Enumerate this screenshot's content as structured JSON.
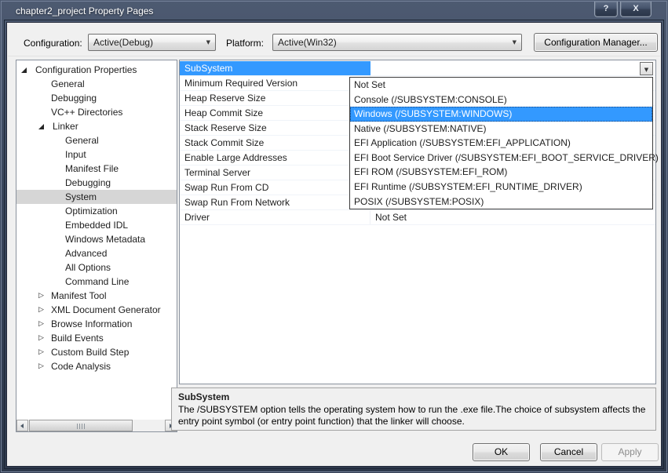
{
  "window": {
    "title": "chapter2_project Property Pages",
    "help_glyph": "?",
    "close_glyph": "X"
  },
  "toolbar": {
    "configuration_label": "Configuration:",
    "configuration_value": "Active(Debug)",
    "platform_label": "Platform:",
    "platform_value": "Active(Win32)",
    "configuration_manager_label": "Configuration Manager..."
  },
  "icons": {
    "dropdown_arrow": "▼",
    "collapsed_arrow": "▷"
  },
  "sidebar": {
    "items": [
      {
        "label": "Configuration Properties",
        "level": 0,
        "state": "expanded",
        "selected": false
      },
      {
        "label": "General",
        "level": 1,
        "state": "leaf",
        "selected": false
      },
      {
        "label": "Debugging",
        "level": 1,
        "state": "leaf",
        "selected": false
      },
      {
        "label": "VC++ Directories",
        "level": 1,
        "state": "leaf",
        "selected": false
      },
      {
        "label": "Linker",
        "level": 1,
        "state": "expanded",
        "selected": false
      },
      {
        "label": "General",
        "level": 2,
        "state": "leaf",
        "selected": false
      },
      {
        "label": "Input",
        "level": 2,
        "state": "leaf",
        "selected": false
      },
      {
        "label": "Manifest File",
        "level": 2,
        "state": "leaf",
        "selected": false
      },
      {
        "label": "Debugging",
        "level": 2,
        "state": "leaf",
        "selected": false
      },
      {
        "label": "System",
        "level": 2,
        "state": "leaf",
        "selected": true
      },
      {
        "label": "Optimization",
        "level": 2,
        "state": "leaf",
        "selected": false
      },
      {
        "label": "Embedded IDL",
        "level": 2,
        "state": "leaf",
        "selected": false
      },
      {
        "label": "Windows Metadata",
        "level": 2,
        "state": "leaf",
        "selected": false
      },
      {
        "label": "Advanced",
        "level": 2,
        "state": "leaf",
        "selected": false
      },
      {
        "label": "All Options",
        "level": 2,
        "state": "leaf",
        "selected": false
      },
      {
        "label": "Command Line",
        "level": 2,
        "state": "leaf",
        "selected": false
      },
      {
        "label": "Manifest Tool",
        "level": 1,
        "state": "collapsed",
        "selected": false
      },
      {
        "label": "XML Document Generator",
        "level": 1,
        "state": "collapsed",
        "selected": false
      },
      {
        "label": "Browse Information",
        "level": 1,
        "state": "collapsed",
        "selected": false
      },
      {
        "label": "Build Events",
        "level": 1,
        "state": "collapsed",
        "selected": false
      },
      {
        "label": "Custom Build Step",
        "level": 1,
        "state": "collapsed",
        "selected": false
      },
      {
        "label": "Code Analysis",
        "level": 1,
        "state": "collapsed",
        "selected": false
      }
    ]
  },
  "grid": {
    "selected_row": "SubSystem",
    "rows": [
      {
        "name": "SubSystem",
        "value": ""
      },
      {
        "name": "Minimum Required Version",
        "value": ""
      },
      {
        "name": "Heap Reserve Size",
        "value": ""
      },
      {
        "name": "Heap Commit Size",
        "value": ""
      },
      {
        "name": "Stack Reserve Size",
        "value": ""
      },
      {
        "name": "Stack Commit Size",
        "value": ""
      },
      {
        "name": "Enable Large Addresses",
        "value": ""
      },
      {
        "name": "Terminal Server",
        "value": ""
      },
      {
        "name": "Swap Run From CD",
        "value": ""
      },
      {
        "name": "Swap Run From Network",
        "value": ""
      },
      {
        "name": "Driver",
        "value": "Not Set"
      }
    ]
  },
  "dropdown": {
    "highlighted": "Windows (/SUBSYSTEM:WINDOWS)",
    "options": [
      "Not Set",
      "Console (/SUBSYSTEM:CONSOLE)",
      "Windows (/SUBSYSTEM:WINDOWS)",
      "Native (/SUBSYSTEM:NATIVE)",
      "EFI Application (/SUBSYSTEM:EFI_APPLICATION)",
      "EFI Boot Service Driver (/SUBSYSTEM:EFI_BOOT_SERVICE_DRIVER)",
      "EFI ROM (/SUBSYSTEM:EFI_ROM)",
      "EFI Runtime (/SUBSYSTEM:EFI_RUNTIME_DRIVER)",
      "POSIX (/SUBSYSTEM:POSIX)"
    ]
  },
  "description": {
    "title": "SubSystem",
    "body": "The /SUBSYSTEM option tells the operating system how to run the .exe file.The choice of subsystem affects the entry point symbol (or entry point function) that the linker will choose."
  },
  "footer": {
    "ok_label": "OK",
    "cancel_label": "Cancel",
    "apply_label": "Apply"
  },
  "colors": {
    "selection_blue": "#3399ff",
    "tree_selection_gray": "#d6d6d6",
    "titlebar_dark": "#3a475d"
  }
}
